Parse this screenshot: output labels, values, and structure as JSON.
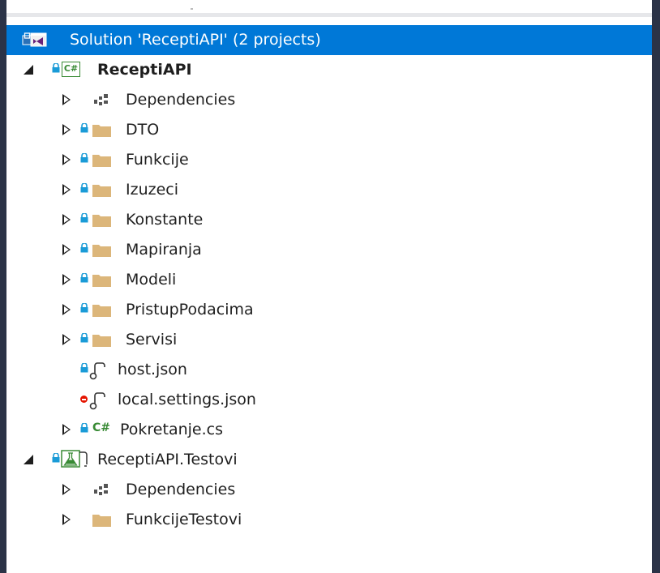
{
  "solution_explorer": {
    "solution": {
      "label": "Solution 'ReceptiAPI' (2 projects)"
    },
    "projects": [
      {
        "name": "ReceptiAPI",
        "items": [
          {
            "label": "Dependencies",
            "kind": "dependencies-icon"
          },
          {
            "label": "DTO",
            "kind": "folder-icon"
          },
          {
            "label": "Funkcije",
            "kind": "folder-icon"
          },
          {
            "label": "Izuzeci",
            "kind": "folder-icon"
          },
          {
            "label": "Konstante",
            "kind": "folder-icon"
          },
          {
            "label": "Mapiranja",
            "kind": "folder-icon"
          },
          {
            "label": "Modeli",
            "kind": "folder-icon"
          },
          {
            "label": "PristupPodacima",
            "kind": "folder-icon"
          },
          {
            "label": "Servisi",
            "kind": "folder-icon"
          },
          {
            "label": "host.json",
            "kind": "json-file-icon"
          },
          {
            "label": "local.settings.json",
            "kind": "json-file-icon"
          },
          {
            "label": "Pokretanje.cs",
            "kind": "csharp-file-icon"
          }
        ]
      },
      {
        "name": "ReceptiAPI.Testovi",
        "items": [
          {
            "label": "Dependencies",
            "kind": "dependencies-icon"
          },
          {
            "label": "FunkcijeTestovi",
            "kind": "folder-icon"
          }
        ]
      }
    ],
    "icon_text": {
      "csharp_badge": "C#"
    },
    "colors": {
      "selection": "#0078d7",
      "folder": "#dcb67a",
      "lock": "#1a9bd7",
      "error": "#e51400",
      "csharp": "#388a34",
      "window_border": "#2b3347"
    }
  }
}
